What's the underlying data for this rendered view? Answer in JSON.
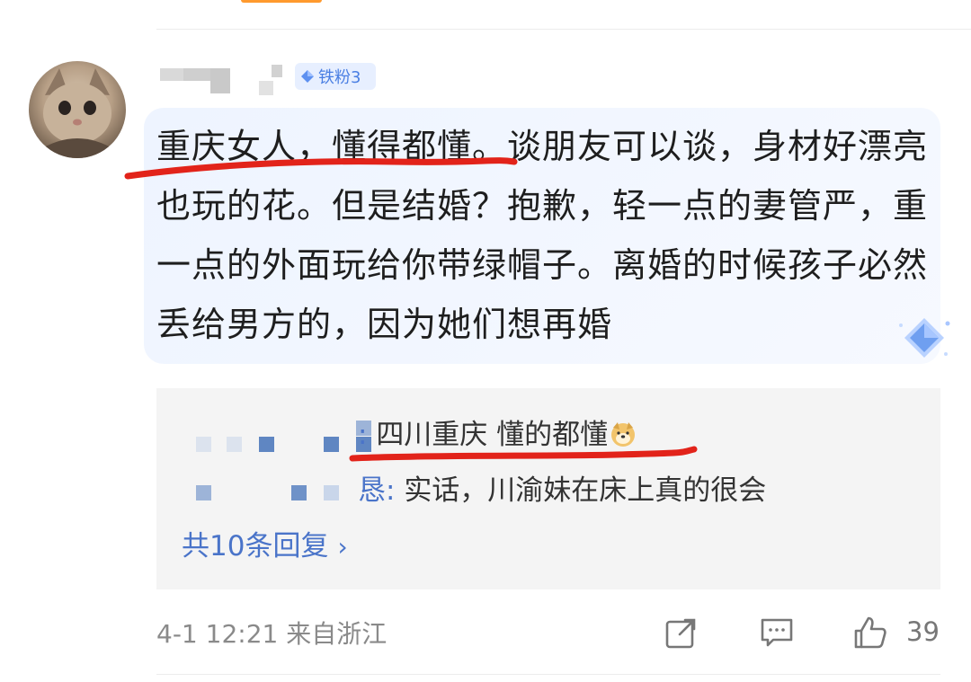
{
  "comment": {
    "fan_badge": {
      "label": "铁粉3",
      "icon": "diamond-icon",
      "color": "#4a7fe3"
    },
    "text": "重庆女人，懂得都懂。谈朋友可以谈，身材好漂亮也玩的花。但是结婚？抱歉，轻一点的妻管严，重一点的外面玩给你带绿帽子。离婚的时候孩子必然丢给男方的，因为她们想再婚",
    "highlight_color": "#e2231a"
  },
  "replies": {
    "items": [
      {
        "prefix": ":",
        "text": "四川重庆 懂的都懂",
        "emoji": "doge-emoji"
      },
      {
        "prefix": "恳:",
        "text": "实话，川渝妹在床上真的很会"
      }
    ],
    "more_label": "共10条回复",
    "more_icon": "chevron-right-icon",
    "link_color": "#4a74c9"
  },
  "footer": {
    "time_location": "4-1 12:21  来自浙江",
    "like_count": "39",
    "icons": [
      "share-icon",
      "comment-icon",
      "like-icon"
    ]
  }
}
